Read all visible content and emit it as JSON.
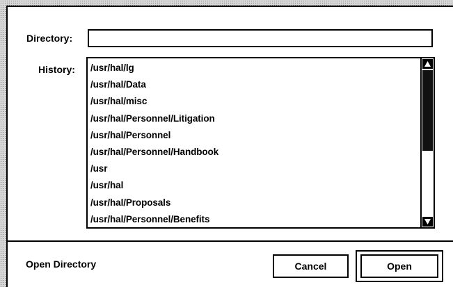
{
  "dialog": {
    "directory_label": "Directory:",
    "directory_value": "",
    "history_label": "History:",
    "history_items": [
      "/usr/hal/lg",
      "/usr/hal/Data",
      "/usr/hal/misc",
      "/usr/hal/Personnel/Litigation",
      "/usr/hal/Personnel",
      "/usr/hal/Personnel/Handbook",
      "/usr",
      "/usr/hal",
      "/usr/hal/Proposals",
      "/usr/hal/Personnel/Benefits"
    ],
    "scrollbar_position": 0.0
  },
  "footer": {
    "status_text": "Open Directory",
    "cancel_label": "Cancel",
    "open_label": "Open"
  },
  "icons": {
    "scroll_up": "triangle-up-icon",
    "scroll_down": "triangle-down-icon"
  }
}
